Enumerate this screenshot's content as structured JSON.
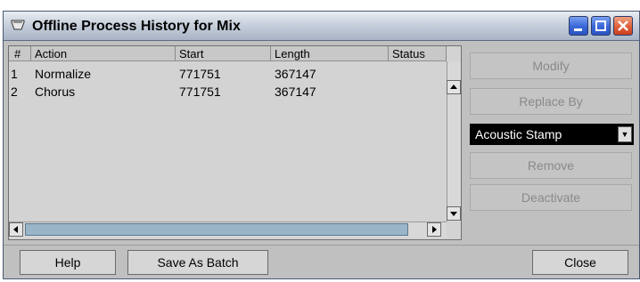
{
  "window": {
    "title": "Offline Process History for Mix"
  },
  "table": {
    "headers": [
      "#",
      "Action",
      "Start",
      "Length",
      "Status"
    ],
    "rows": [
      {
        "num": "1",
        "action": "Normalize",
        "start": "771751",
        "length": "367147",
        "status": ""
      },
      {
        "num": "2",
        "action": "Chorus",
        "start": "771751",
        "length": "367147",
        "status": ""
      }
    ]
  },
  "side_buttons": {
    "modify": "Modify",
    "replace_by": "Replace By",
    "dropdown_value": "Acoustic Stamp",
    "remove": "Remove",
    "deactivate": "Deactivate"
  },
  "bottom_buttons": {
    "help": "Help",
    "save_as_batch": "Save As Batch",
    "close": "Close"
  },
  "icons": [
    "app-icon",
    "minimize-icon",
    "maximize-icon",
    "close-icon",
    "scroll-up-icon",
    "scroll-down-icon",
    "scroll-left-icon",
    "scroll-right-icon",
    "dropdown-arrow-icon"
  ]
}
